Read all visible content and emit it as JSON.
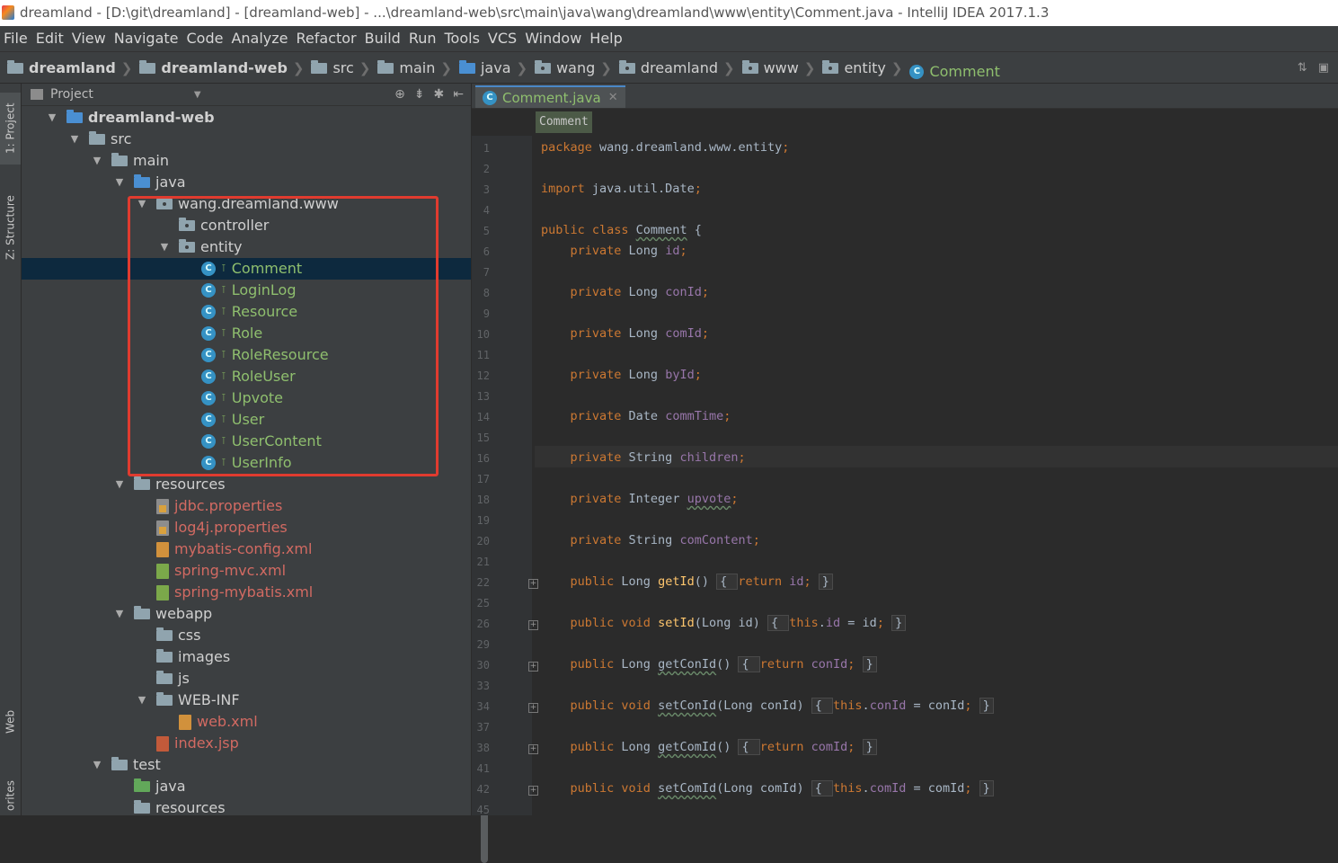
{
  "window": {
    "title": "dreamland - [D:\\git\\dreamland] - [dreamland-web] - ...\\dreamland-web\\src\\main\\java\\wang\\dreamland\\www\\entity\\Comment.java - IntelliJ IDEA 2017.1.3"
  },
  "menu": [
    "File",
    "Edit",
    "View",
    "Navigate",
    "Code",
    "Analyze",
    "Refactor",
    "Build",
    "Run",
    "Tools",
    "VCS",
    "Window",
    "Help"
  ],
  "breadcrumb": [
    {
      "label": "dreamland",
      "icon": "module-folder-icon",
      "bold": true
    },
    {
      "label": "dreamland-web",
      "icon": "module-folder-icon",
      "bold": true
    },
    {
      "label": "src",
      "icon": "folder-icon"
    },
    {
      "label": "main",
      "icon": "folder-icon"
    },
    {
      "label": "java",
      "icon": "source-folder-icon"
    },
    {
      "label": "wang",
      "icon": "package-icon"
    },
    {
      "label": "dreamland",
      "icon": "package-icon"
    },
    {
      "label": "www",
      "icon": "package-icon"
    },
    {
      "label": "entity",
      "icon": "package-icon"
    },
    {
      "label": "Comment",
      "icon": "class-icon"
    }
  ],
  "toolwindows": {
    "project": "1: Project",
    "structure": "Z: Structure",
    "web": "Web",
    "favorites": "orites"
  },
  "project_panel": {
    "title": "Project"
  },
  "tree": [
    {
      "label": "dreamland-web",
      "level": 0,
      "expanded": true,
      "kind": "module"
    },
    {
      "label": "src",
      "level": 1,
      "expanded": true,
      "kind": "folder"
    },
    {
      "label": "main",
      "level": 2,
      "expanded": true,
      "kind": "folder"
    },
    {
      "label": "java",
      "level": 3,
      "expanded": true,
      "kind": "src"
    },
    {
      "label": "wang.dreamland.www",
      "level": 4,
      "expanded": true,
      "kind": "package"
    },
    {
      "label": "controller",
      "level": 5,
      "expanded": false,
      "kind": "package"
    },
    {
      "label": "entity",
      "level": 5,
      "expanded": true,
      "kind": "package"
    },
    {
      "label": "Comment",
      "level": 6,
      "kind": "class",
      "selected": true
    },
    {
      "label": "LoginLog",
      "level": 6,
      "kind": "class"
    },
    {
      "label": "Resource",
      "level": 6,
      "kind": "class"
    },
    {
      "label": "Role",
      "level": 6,
      "kind": "class"
    },
    {
      "label": "RoleResource",
      "level": 6,
      "kind": "class"
    },
    {
      "label": "RoleUser",
      "level": 6,
      "kind": "class"
    },
    {
      "label": "Upvote",
      "level": 6,
      "kind": "class"
    },
    {
      "label": "User",
      "level": 6,
      "kind": "class"
    },
    {
      "label": "UserContent",
      "level": 6,
      "kind": "class"
    },
    {
      "label": "UserInfo",
      "level": 6,
      "kind": "class"
    },
    {
      "label": "resources",
      "level": 3,
      "expanded": true,
      "kind": "resfolder"
    },
    {
      "label": "jdbc.properties",
      "level": 4,
      "kind": "props"
    },
    {
      "label": "log4j.properties",
      "level": 4,
      "kind": "props"
    },
    {
      "label": "mybatis-config.xml",
      "level": 4,
      "kind": "xml"
    },
    {
      "label": "spring-mvc.xml",
      "level": 4,
      "kind": "spring"
    },
    {
      "label": "spring-mybatis.xml",
      "level": 4,
      "kind": "spring"
    },
    {
      "label": "webapp",
      "level": 3,
      "expanded": true,
      "kind": "folder"
    },
    {
      "label": "css",
      "level": 4,
      "kind": "folder"
    },
    {
      "label": "images",
      "level": 4,
      "kind": "folder"
    },
    {
      "label": "js",
      "level": 4,
      "kind": "folder"
    },
    {
      "label": "WEB-INF",
      "level": 4,
      "expanded": true,
      "kind": "folder"
    },
    {
      "label": "web.xml",
      "level": 5,
      "kind": "webxml"
    },
    {
      "label": "index.jsp",
      "level": 4,
      "kind": "jsp"
    },
    {
      "label": "test",
      "level": 2,
      "expanded": true,
      "kind": "folder"
    },
    {
      "label": "java",
      "level": 3,
      "kind": "testsrc"
    },
    {
      "label": "resources",
      "level": 3,
      "kind": "resfolder"
    }
  ],
  "editor": {
    "tab": "Comment.java",
    "crumb": "Comment",
    "lines": [
      {
        "n": "1",
        "parts": [
          [
            "kw",
            "package "
          ],
          [
            "",
            "wang.dreamland.www.entity"
          ],
          [
            "kw",
            ";"
          ]
        ]
      },
      {
        "n": "2",
        "parts": []
      },
      {
        "n": "3",
        "parts": [
          [
            "kw",
            "import "
          ],
          [
            "",
            "java.util.Date"
          ],
          [
            "kw",
            ";"
          ]
        ]
      },
      {
        "n": "4",
        "parts": []
      },
      {
        "n": "5",
        "parts": [
          [
            "kw",
            "public class "
          ],
          [
            "und",
            "Comment"
          ],
          [
            "",
            " {"
          ]
        ]
      },
      {
        "n": "6",
        "parts": [
          [
            "",
            "    "
          ],
          [
            "kw",
            "private "
          ],
          [
            "",
            "Long "
          ],
          [
            "fld",
            "id"
          ],
          [
            "kw",
            ";"
          ]
        ]
      },
      {
        "n": "7",
        "parts": []
      },
      {
        "n": "8",
        "parts": [
          [
            "",
            "    "
          ],
          [
            "kw",
            "private "
          ],
          [
            "",
            "Long "
          ],
          [
            "fld",
            "conId"
          ],
          [
            "kw",
            ";"
          ]
        ]
      },
      {
        "n": "9",
        "parts": []
      },
      {
        "n": "10",
        "parts": [
          [
            "",
            "    "
          ],
          [
            "kw",
            "private "
          ],
          [
            "",
            "Long "
          ],
          [
            "fld",
            "comId"
          ],
          [
            "kw",
            ";"
          ]
        ]
      },
      {
        "n": "11",
        "parts": []
      },
      {
        "n": "12",
        "parts": [
          [
            "",
            "    "
          ],
          [
            "kw",
            "private "
          ],
          [
            "",
            "Long "
          ],
          [
            "fld",
            "byId"
          ],
          [
            "kw",
            ";"
          ]
        ]
      },
      {
        "n": "13",
        "parts": []
      },
      {
        "n": "14",
        "parts": [
          [
            "",
            "    "
          ],
          [
            "kw",
            "private "
          ],
          [
            "",
            "Date "
          ],
          [
            "fld",
            "commTime"
          ],
          [
            "kw",
            ";"
          ]
        ]
      },
      {
        "n": "15",
        "parts": []
      },
      {
        "n": "16",
        "parts": [
          [
            "",
            "    "
          ],
          [
            "kw",
            "private "
          ],
          [
            "",
            "String "
          ],
          [
            "fld",
            "children"
          ],
          [
            "kw",
            ";"
          ]
        ]
      },
      {
        "n": "17",
        "parts": []
      },
      {
        "n": "18",
        "parts": [
          [
            "",
            "    "
          ],
          [
            "kw",
            "private "
          ],
          [
            "",
            "Integer "
          ],
          [
            "fld und",
            "upvote"
          ],
          [
            "kw",
            ";"
          ]
        ]
      },
      {
        "n": "19",
        "parts": []
      },
      {
        "n": "20",
        "parts": [
          [
            "",
            "    "
          ],
          [
            "kw",
            "private "
          ],
          [
            "",
            "String "
          ],
          [
            "fld",
            "comContent"
          ],
          [
            "kw",
            ";"
          ]
        ]
      },
      {
        "n": "21",
        "parts": []
      },
      {
        "n": "22",
        "fold": true,
        "parts": [
          [
            "",
            "    "
          ],
          [
            "kw",
            "public "
          ],
          [
            "",
            "Long "
          ],
          [
            "mth",
            "getId"
          ],
          [
            "",
            "() "
          ],
          [
            "fb",
            "{ "
          ],
          [
            "kw",
            "return "
          ],
          [
            "fld",
            "id"
          ],
          [
            "kw",
            "; "
          ],
          [
            "fb",
            "}"
          ]
        ]
      },
      {
        "n": "25",
        "parts": []
      },
      {
        "n": "26",
        "fold": true,
        "parts": [
          [
            "",
            "    "
          ],
          [
            "kw",
            "public void "
          ],
          [
            "mth",
            "setId"
          ],
          [
            "",
            "(Long id) "
          ],
          [
            "fb",
            "{ "
          ],
          [
            "kw",
            "this"
          ],
          [
            "",
            "."
          ],
          [
            "fld",
            "id "
          ],
          [
            "",
            "= id"
          ],
          [
            "kw",
            "; "
          ],
          [
            "fb",
            "}"
          ]
        ]
      },
      {
        "n": "29",
        "parts": []
      },
      {
        "n": "30",
        "fold": true,
        "parts": [
          [
            "",
            "    "
          ],
          [
            "kw",
            "public "
          ],
          [
            "",
            "Long "
          ],
          [
            "und",
            "getConId"
          ],
          [
            "",
            "() "
          ],
          [
            "fb",
            "{ "
          ],
          [
            "kw",
            "return "
          ],
          [
            "fld",
            "conId"
          ],
          [
            "kw",
            "; "
          ],
          [
            "fb",
            "}"
          ]
        ]
      },
      {
        "n": "33",
        "parts": []
      },
      {
        "n": "34",
        "fold": true,
        "parts": [
          [
            "",
            "    "
          ],
          [
            "kw",
            "public void "
          ],
          [
            "und",
            "setConId"
          ],
          [
            "",
            "(Long conId) "
          ],
          [
            "fb",
            "{ "
          ],
          [
            "kw",
            "this"
          ],
          [
            "",
            "."
          ],
          [
            "fld",
            "conId "
          ],
          [
            "",
            "= conId"
          ],
          [
            "kw",
            "; "
          ],
          [
            "fb",
            "}"
          ]
        ]
      },
      {
        "n": "37",
        "parts": []
      },
      {
        "n": "38",
        "fold": true,
        "parts": [
          [
            "",
            "    "
          ],
          [
            "kw",
            "public "
          ],
          [
            "",
            "Long "
          ],
          [
            "und",
            "getComId"
          ],
          [
            "",
            "() "
          ],
          [
            "fb",
            "{ "
          ],
          [
            "kw",
            "return "
          ],
          [
            "fld",
            "comId"
          ],
          [
            "kw",
            "; "
          ],
          [
            "fb",
            "}"
          ]
        ]
      },
      {
        "n": "41",
        "parts": []
      },
      {
        "n": "42",
        "fold": true,
        "parts": [
          [
            "",
            "    "
          ],
          [
            "kw",
            "public void "
          ],
          [
            "und",
            "setComId"
          ],
          [
            "",
            "(Long comId) "
          ],
          [
            "fb",
            "{ "
          ],
          [
            "kw",
            "this"
          ],
          [
            "",
            "."
          ],
          [
            "fld",
            "comId "
          ],
          [
            "",
            "= comId"
          ],
          [
            "kw",
            "; "
          ],
          [
            "fb",
            "}"
          ]
        ]
      },
      {
        "n": "45",
        "parts": []
      }
    ]
  }
}
